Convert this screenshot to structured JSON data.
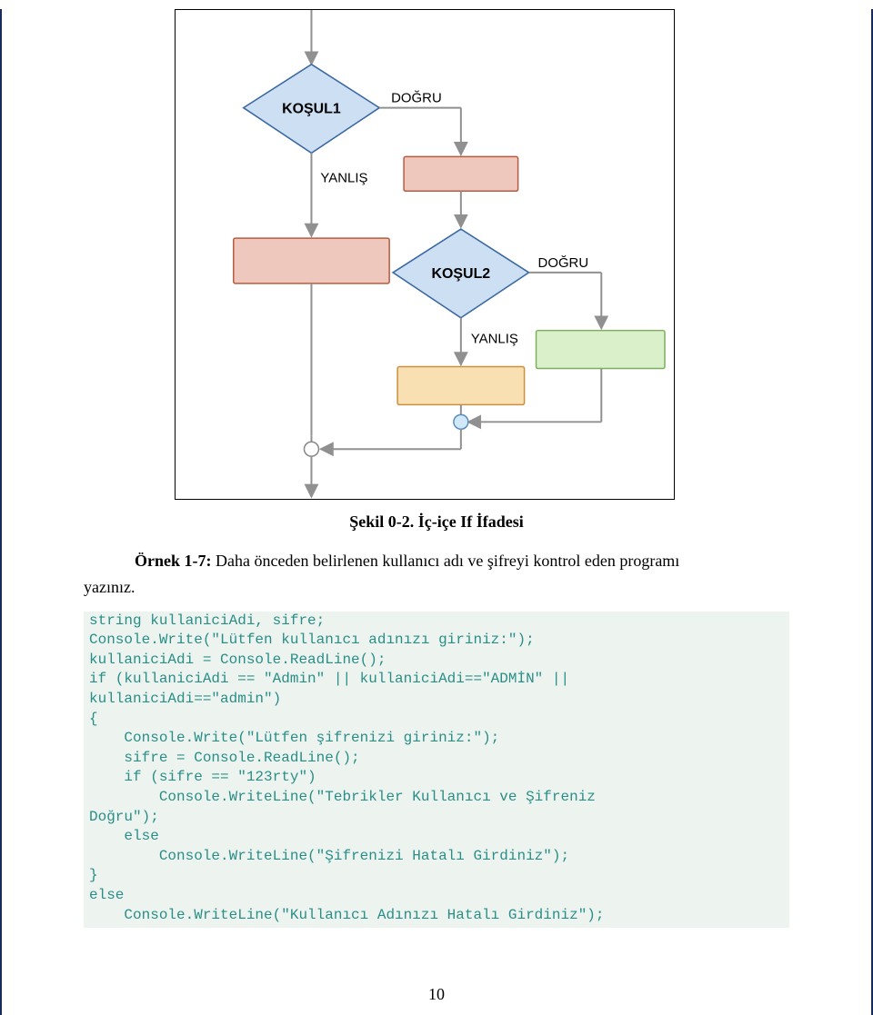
{
  "flowchart": {
    "kosul1": "KOŞUL1",
    "dogru1": "DOĞRU",
    "yanlis1": "YANLIŞ",
    "kosul2": "KOŞUL2",
    "dogru2": "DOĞRU",
    "yanlis2": "YANLIŞ"
  },
  "caption": "Şekil 0-2. İç-içe If İfadesi",
  "example": {
    "title": "Örnek 1-7:",
    "text_part1": " Daha önceden belirlenen kullanıcı adı ve şifreyi kontrol eden programı",
    "text_part2": "yazınız."
  },
  "code": "string kullaniciAdi, sifre;\nConsole.Write(\"Lütfen kullanıcı adınızı giriniz:\");\nkullaniciAdi = Console.ReadLine();\nif (kullaniciAdi == \"Admin\" || kullaniciAdi==\"ADMİN\" || \nkullaniciAdi==\"admin\")\n{\n    Console.Write(\"Lütfen şifrenizi giriniz:\");\n    sifre = Console.ReadLine();\n    if (sifre == \"123rty\")\n        Console.WriteLine(\"Tebrikler Kullanıcı ve Şifreniz \nDoğru\");\n    else\n        Console.WriteLine(\"Şifrenizi Hatalı Girdiniz\");\n}\nelse\n    Console.WriteLine(\"Kullanıcı Adınızı Hatalı Girdiniz\");",
  "pagenum": "10"
}
